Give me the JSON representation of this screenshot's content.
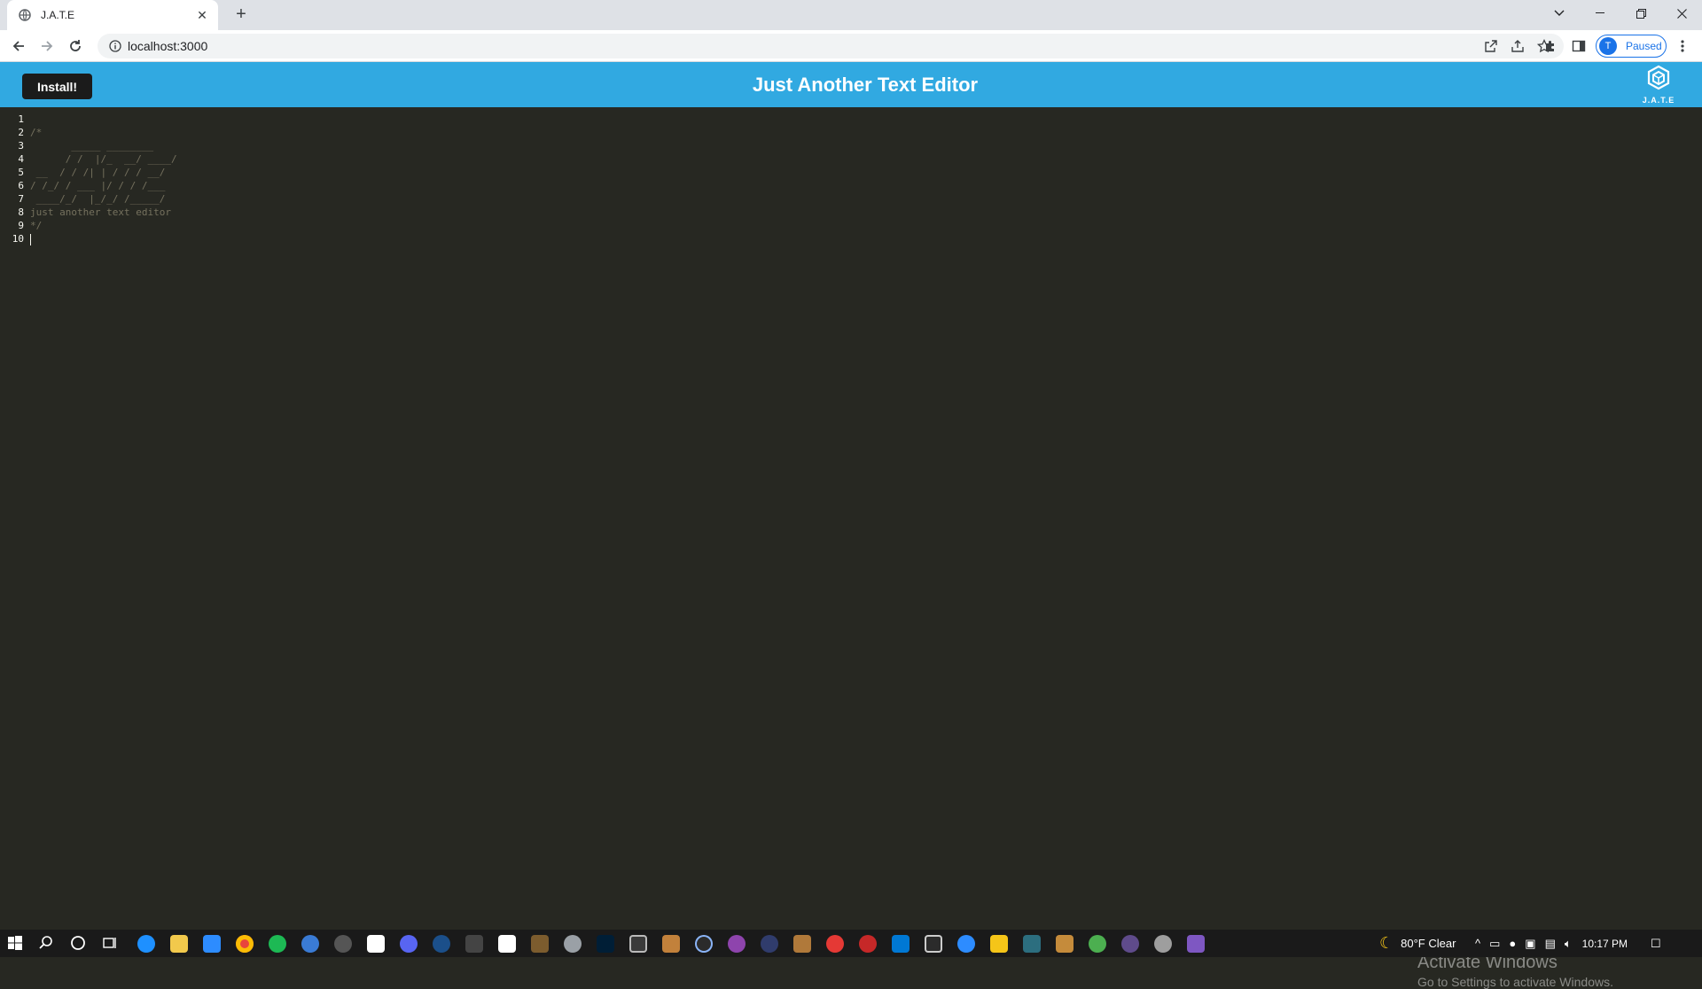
{
  "browser": {
    "tab_title": "J.A.T.E",
    "url": "localhost:3000",
    "profile_initial": "T",
    "profile_status": "Paused"
  },
  "app": {
    "install_label": "Install!",
    "title": "Just Another Text Editor",
    "logo_text": "J.A.T.E",
    "accent_color": "#31a9e1"
  },
  "editor": {
    "line_numbers": [
      "1",
      "2",
      "3",
      "4",
      "5",
      "6",
      "7",
      "8",
      "9",
      "10"
    ],
    "lines": [
      "",
      "/*",
      "       _____ ________",
      "      / /  |/_  __/ ____/",
      " __  / / /| | / / / __/",
      "/ /_/ / ___ |/ / / /___",
      " ____/_/  |_/_/ /_____/",
      "just another text editor",
      "*/",
      ""
    ]
  },
  "watermark": {
    "title": "Activate Windows",
    "subtitle": "Go to Settings to activate Windows."
  },
  "taskbar": {
    "weather": "80°F  Clear",
    "time": "10:17 PM"
  }
}
